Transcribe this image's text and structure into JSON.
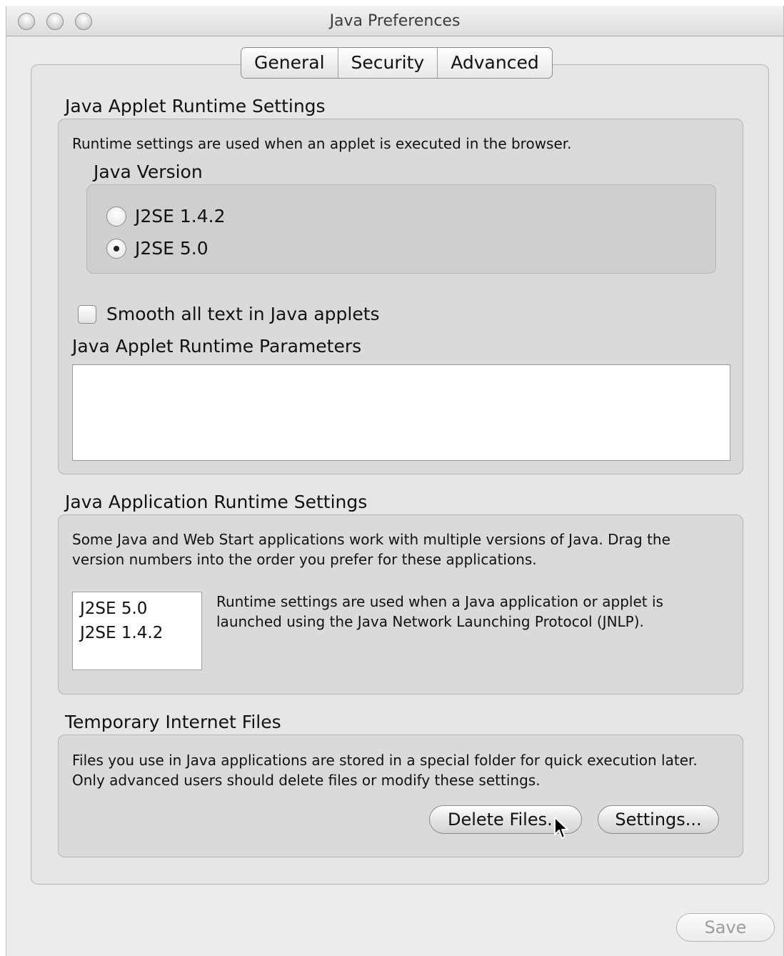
{
  "window": {
    "title": "Java Preferences"
  },
  "tabs": [
    {
      "label": "General",
      "selected": true
    },
    {
      "label": "Security",
      "selected": false
    },
    {
      "label": "Advanced",
      "selected": false
    }
  ],
  "applet_runtime": {
    "title": "Java Applet Runtime Settings",
    "description": "Runtime settings are used when an applet is executed in the browser.",
    "java_version": {
      "label": "Java Version",
      "options": [
        {
          "label": "J2SE 1.4.2",
          "selected": false
        },
        {
          "label": "J2SE 5.0",
          "selected": true
        }
      ]
    },
    "smooth_text": {
      "label": "Smooth all text in Java applets",
      "checked": false
    },
    "parameters": {
      "label": "Java Applet Runtime Parameters",
      "value": ""
    }
  },
  "application_runtime": {
    "title": "Java Application Runtime Settings",
    "description": "Some Java and Web Start applications work with multiple versions of Java. Drag the version numbers into the order you prefer for these applications.",
    "versions": [
      "J2SE 5.0",
      "J2SE 1.4.2"
    ],
    "note": "Runtime settings are used when a Java application or applet is launched using the Java Network Launching Protocol (JNLP)."
  },
  "temp_files": {
    "title": "Temporary Internet Files",
    "description": "Files you use in Java applications are stored in a special folder for quick execution later.  Only advanced users should delete files or modify these settings.",
    "delete_label": "Delete Files...",
    "settings_label": "Settings..."
  },
  "footer": {
    "save_label": "Save"
  },
  "icons": {
    "close": "traffic-light-close",
    "minimize": "traffic-light-minimize",
    "zoom": "traffic-light-zoom",
    "cursor": "arrow-cursor"
  }
}
